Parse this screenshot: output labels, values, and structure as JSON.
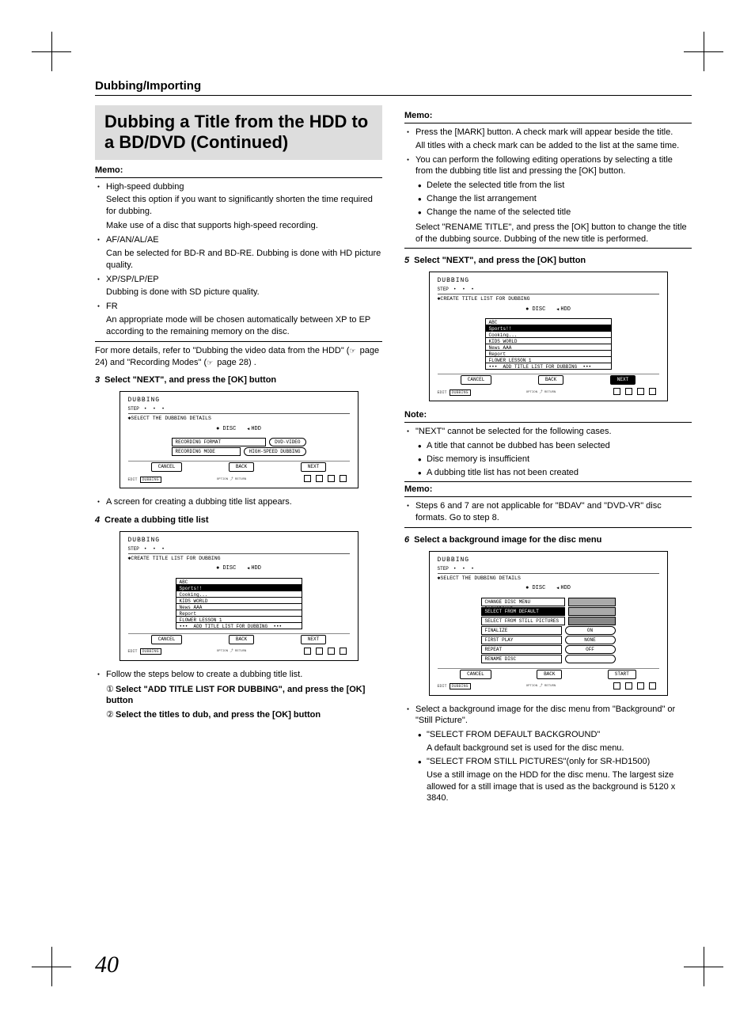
{
  "header": {
    "section": "Dubbing/Importing"
  },
  "title": "Dubbing a Title from the HDD to a BD/DVD (Continued)",
  "memo_label": "Memo:",
  "note_label": "Note:",
  "left": {
    "m1": {
      "i1": "High-speed dubbing",
      "i1a": "Select this option if you want to significantly shorten the time required for dubbing.",
      "i1b": "Make use of a disc that supports high-speed recording.",
      "i2": "AF/AN/AL/AE",
      "i2a": "Can be selected for BD-R and BD-RE. Dubbing is done with HD picture quality.",
      "i3": "XP/SP/LP/EP",
      "i3a": "Dubbing is done with SD picture quality.",
      "i4": "FR",
      "i4a": "An appropriate mode will be chosen automatically between XP to EP according to the remaining memory on the disc."
    },
    "details": "For more details, refer to \"Dubbing the video data from the HDD\" ( page 24) and \"Recording Modes\" ( page 28) .",
    "step3": {
      "n": "3",
      "t": "Select \"NEXT\", and press the [OK] button"
    },
    "scr1_note": "A screen for creating a dubbing title list appears.",
    "step4": {
      "n": "4",
      "t": "Create a dubbing title list"
    },
    "follow": "Follow the steps below to create a dubbing title list.",
    "c1n": "①",
    "c1": "Select \"ADD TITLE LIST FOR DUBBING\", and press the [OK] button",
    "c2n": "②",
    "c2": "Select the titles to dub, and press the [OK] button"
  },
  "right": {
    "m1": {
      "i1": "Press the [MARK] button. A check mark will appear beside the title.",
      "i1a": "All titles with a check mark can be added to the list at the same time.",
      "i2": "You can perform the following editing operations by selecting a title from the dubbing title list and pressing the [OK] button.",
      "s1": "Delete the selected title from the list",
      "s2": "Change the list arrangement",
      "s3": "Change the name of the selected title",
      "i3": "Select \"RENAME TITLE\", and press the [OK] button to change the title of the dubbing source. Dubbing of the new title is performed."
    },
    "step5": {
      "n": "5",
      "t": "Select \"NEXT\", and press the [OK] button"
    },
    "note": {
      "i1": "\"NEXT\" cannot be selected for the following cases.",
      "s1": "A title that cannot be dubbed has been selected",
      "s2": "Disc memory is insufficient",
      "s3": "A dubbing title list has not been created"
    },
    "m2": "Steps 6 and 7 are not applicable for \"BDAV\" and \"DVD-VR\" disc formats. Go to step 8.",
    "step6": {
      "n": "6",
      "t": "Select a background image for the disc menu"
    },
    "sel": "Select a background image for the disc menu from \"Background\" or \"Still Picture\".",
    "opt1": "\"SELECT FROM DEFAULT BACKGROUND\"",
    "opt1a": "A default background set is used for the disc menu.",
    "opt2": "\"SELECT FROM STILL PICTURES\"(only for SR-HD1500)",
    "opt2a": "Use a still image on the HDD for the disc menu. The largest size allowed for a still image that is used as the background is 5120 x 3840."
  },
  "ui": {
    "title": "DUBBING",
    "step": "STEP",
    "sub_details": "SELECT THE DUBBING DETAILS",
    "sub_list": "CREATE TITLE LIST FOR DUBBING",
    "disc": "DISC",
    "hdd": "HDD",
    "rec_fmt": "RECORDING FORMAT",
    "rec_fmt_v": "DVD-VIDEO",
    "rec_mode": "RECORDING MODE",
    "rec_mode_v": "HIGH-SPEED DUBBING",
    "cancel": "CANCEL",
    "back": "BACK",
    "next": "NEXT",
    "start": "START",
    "edit": "EDIT",
    "dubbing_small": "DUBBING",
    "option": "OPTION",
    "return": "RETURN",
    "list": [
      "ABC",
      "Sports!!",
      "Cooking...",
      "KIDS WORLD",
      "News AAA",
      "Report",
      "FLOWER LESSON 1"
    ],
    "add_title": "ADD TITLE LIST FOR DUBBING",
    "bg1": "CHANGE DISC MENU BACKGROUND",
    "bg2": "SELECT FROM DEFAULT BACKGROUND",
    "bg3": "SELECT FROM STILL PICTURES",
    "fin": "FINALIZE",
    "fin_v": "ON",
    "fp": "FIRST PLAY",
    "fp_v": "NONE",
    "rep": "REPEAT",
    "rep_v": "OFF",
    "ren": "RENAME DISC"
  },
  "page_number": "40"
}
